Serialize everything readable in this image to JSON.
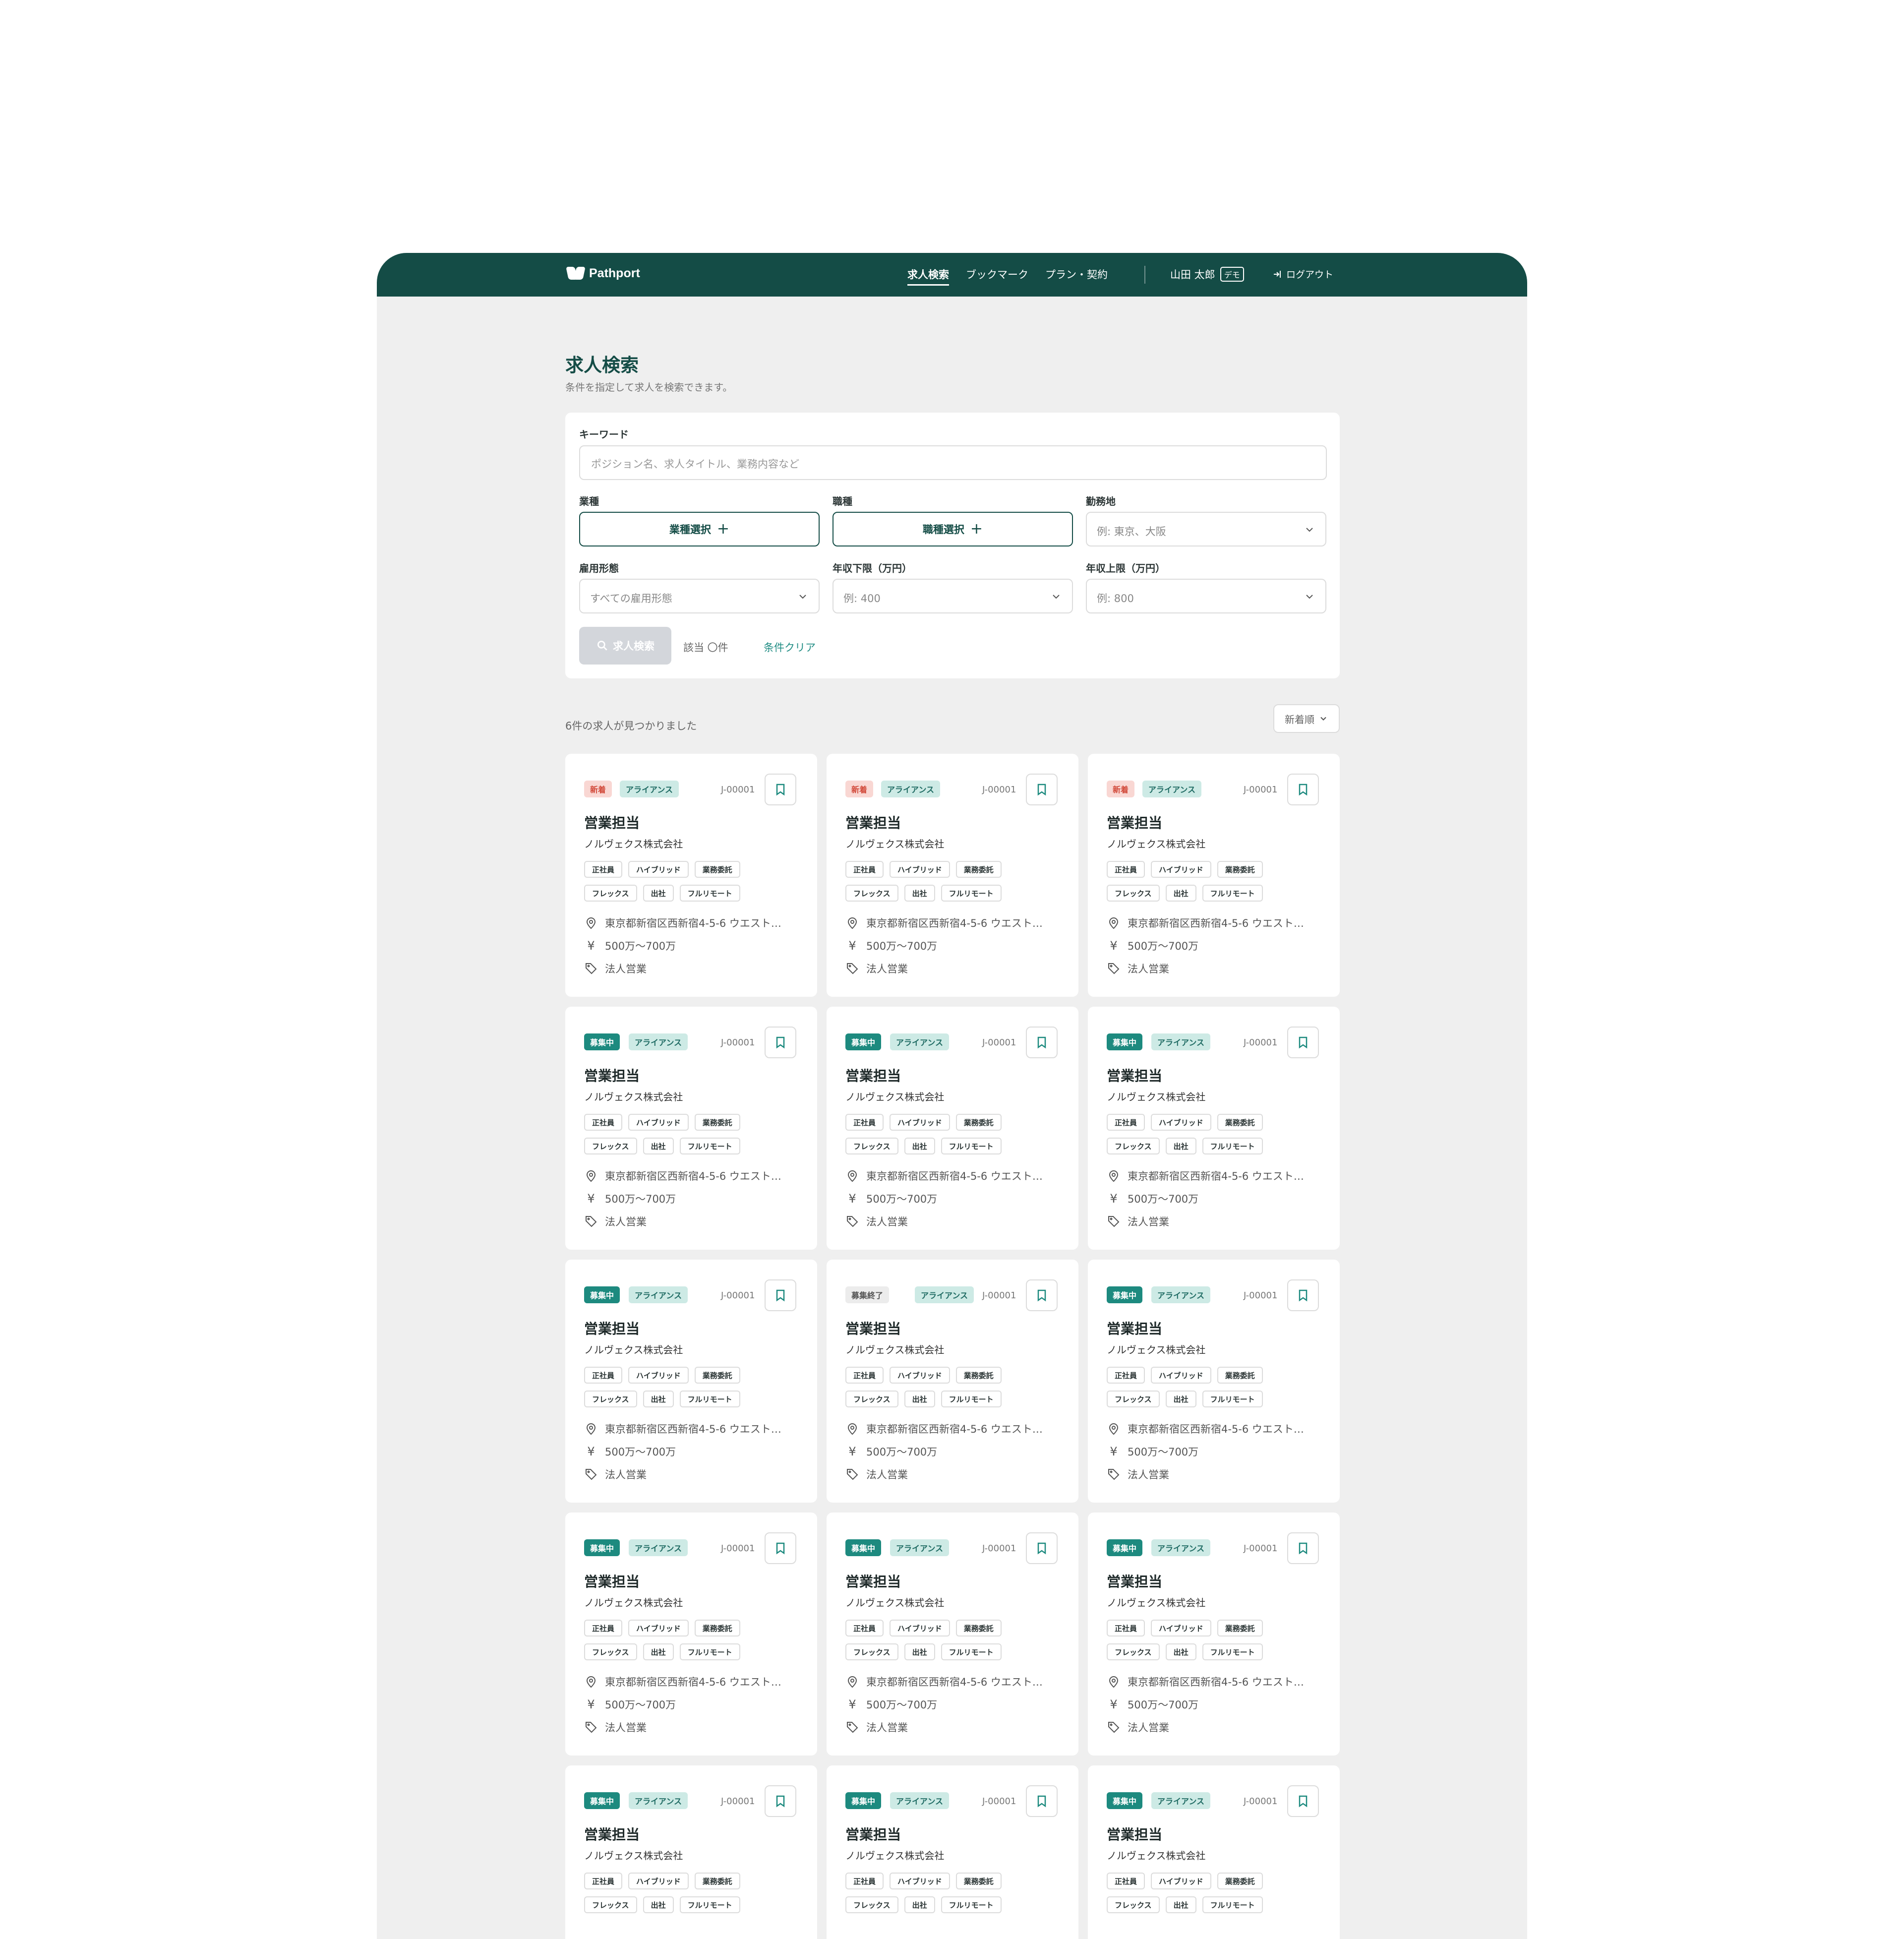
{
  "nav": {
    "logo": "Pathport",
    "links": [
      "求人検索",
      "ブックマーク",
      "プラン・契約"
    ],
    "user_name": "山田 太郎",
    "demo_label": "デモ",
    "logout": "ログアウト"
  },
  "page": {
    "title": "求人検索",
    "subtitle": "条件を指定して求人を検索できます。"
  },
  "search": {
    "keyword_label": "キーワード",
    "keyword_placeholder": "ポジション名、求人タイトル、業務内容など",
    "industry_label": "業種",
    "industry_button": "業種選択",
    "occupation_label": "職種",
    "occupation_button": "職種選択",
    "location_label": "勤務地",
    "location_placeholder": "例: 東京、大阪",
    "employment_label": "雇用形態",
    "employment_value": "すべての雇用形態",
    "salary_min_label": "年収下限（万円）",
    "salary_min_placeholder": "例: 400",
    "salary_max_label": "年収上限（万円）",
    "salary_max_placeholder": "例: 800",
    "search_button": "求人検索",
    "match_count": "該当 〇件",
    "clear_link": "条件クリア"
  },
  "results": {
    "count_text": "6件の求人が見つかりました",
    "sort_label": "新着順"
  },
  "alliance_label": "アライアンス",
  "cards": [
    {
      "status": "新着",
      "status_type": "new",
      "id": "J-00001",
      "title": "営業担当",
      "company": "ノルヴェクス株式会社",
      "tags_row1": [
        "正社員",
        "ハイブリッド",
        "業務委託"
      ],
      "tags_row2": [
        "フレックス",
        "出社",
        "フルリモート"
      ],
      "location": "東京都新宿区西新宿4-5-6 ウエスト…",
      "salary": "500万〜700万",
      "category": "法人営業"
    },
    {
      "status": "新着",
      "status_type": "new",
      "id": "J-00001",
      "title": "営業担当",
      "company": "ノルヴェクス株式会社",
      "tags_row1": [
        "正社員",
        "ハイブリッド",
        "業務委託"
      ],
      "tags_row2": [
        "フレックス",
        "出社",
        "フルリモート"
      ],
      "location": "東京都新宿区西新宿4-5-6 ウエスト…",
      "salary": "500万〜700万",
      "category": "法人営業"
    },
    {
      "status": "新着",
      "status_type": "new",
      "id": "J-00001",
      "title": "営業担当",
      "company": "ノルヴェクス株式会社",
      "tags_row1": [
        "正社員",
        "ハイブリッド",
        "業務委託"
      ],
      "tags_row2": [
        "フレックス",
        "出社",
        "フルリモート"
      ],
      "location": "東京都新宿区西新宿4-5-6 ウエスト…",
      "salary": "500万〜700万",
      "category": "法人営業"
    },
    {
      "status": "募集中",
      "status_type": "open",
      "id": "J-00001",
      "title": "営業担当",
      "company": "ノルヴェクス株式会社",
      "tags_row1": [
        "正社員",
        "ハイブリッド",
        "業務委託"
      ],
      "tags_row2": [
        "フレックス",
        "出社",
        "フルリモート"
      ],
      "location": "東京都新宿区西新宿4-5-6 ウエスト…",
      "salary": "500万〜700万",
      "category": "法人営業"
    },
    {
      "status": "募集中",
      "status_type": "open",
      "id": "J-00001",
      "title": "営業担当",
      "company": "ノルヴェクス株式会社",
      "tags_row1": [
        "正社員",
        "ハイブリッド",
        "業務委託"
      ],
      "tags_row2": [
        "フレックス",
        "出社",
        "フルリモート"
      ],
      "location": "東京都新宿区西新宿4-5-6 ウエスト…",
      "salary": "500万〜700万",
      "category": "法人営業"
    },
    {
      "status": "募集中",
      "status_type": "open",
      "id": "J-00001",
      "title": "営業担当",
      "company": "ノルヴェクス株式会社",
      "tags_row1": [
        "正社員",
        "ハイブリッド",
        "業務委託"
      ],
      "tags_row2": [
        "フレックス",
        "出社",
        "フルリモート"
      ],
      "location": "東京都新宿区西新宿4-5-6 ウエスト…",
      "salary": "500万〜700万",
      "category": "法人営業"
    },
    {
      "status": "募集中",
      "status_type": "open",
      "id": "J-00001",
      "title": "営業担当",
      "company": "ノルヴェクス株式会社",
      "tags_row1": [
        "正社員",
        "ハイブリッド",
        "業務委託"
      ],
      "tags_row2": [
        "フレックス",
        "出社",
        "フルリモート"
      ],
      "location": "東京都新宿区西新宿4-5-6 ウエスト…",
      "salary": "500万〜700万",
      "category": "法人営業"
    },
    {
      "status": "募集終了",
      "status_type": "closed",
      "id": "J-00001",
      "title": "営業担当",
      "company": "ノルヴェクス株式会社",
      "tags_row1": [
        "正社員",
        "ハイブリッド",
        "業務委託"
      ],
      "tags_row2": [
        "フレックス",
        "出社",
        "フルリモート"
      ],
      "location": "東京都新宿区西新宿4-5-6 ウエスト…",
      "salary": "500万〜700万",
      "category": "法人営業"
    },
    {
      "status": "募集中",
      "status_type": "open",
      "id": "J-00001",
      "title": "営業担当",
      "company": "ノルヴェクス株式会社",
      "tags_row1": [
        "正社員",
        "ハイブリッド",
        "業務委託"
      ],
      "tags_row2": [
        "フレックス",
        "出社",
        "フルリモート"
      ],
      "location": "東京都新宿区西新宿4-5-6 ウエスト…",
      "salary": "500万〜700万",
      "category": "法人営業"
    },
    {
      "status": "募集中",
      "status_type": "open",
      "id": "J-00001",
      "title": "営業担当",
      "company": "ノルヴェクス株式会社",
      "tags_row1": [
        "正社員",
        "ハイブリッド",
        "業務委託"
      ],
      "tags_row2": [
        "フレックス",
        "出社",
        "フルリモート"
      ],
      "location": "東京都新宿区西新宿4-5-6 ウエスト…",
      "salary": "500万〜700万",
      "category": "法人営業"
    },
    {
      "status": "募集中",
      "status_type": "open",
      "id": "J-00001",
      "title": "営業担当",
      "company": "ノルヴェクス株式会社",
      "tags_row1": [
        "正社員",
        "ハイブリッド",
        "業務委託"
      ],
      "tags_row2": [
        "フレックス",
        "出社",
        "フルリモート"
      ],
      "location": "東京都新宿区西新宿4-5-6 ウエスト…",
      "salary": "500万〜700万",
      "category": "法人営業"
    },
    {
      "status": "募集中",
      "status_type": "open",
      "id": "J-00001",
      "title": "営業担当",
      "company": "ノルヴェクス株式会社",
      "tags_row1": [
        "正社員",
        "ハイブリッド",
        "業務委託"
      ],
      "tags_row2": [
        "フレックス",
        "出社",
        "フルリモート"
      ],
      "location": "東京都新宿区西新宿4-5-6 ウエスト…",
      "salary": "500万〜700万",
      "category": "法人営業"
    },
    {
      "status": "募集中",
      "status_type": "open",
      "id": "J-00001",
      "title": "営業担当",
      "company": "ノルヴェクス株式会社",
      "tags_row1": [
        "正社員",
        "ハイブリッド",
        "業務委託"
      ],
      "tags_row2": [
        "フレックス",
        "出社",
        "フルリモート"
      ],
      "location": "",
      "salary": "",
      "category": ""
    },
    {
      "status": "募集中",
      "status_type": "open",
      "id": "J-00001",
      "title": "営業担当",
      "company": "ノルヴェクス株式会社",
      "tags_row1": [
        "正社員",
        "ハイブリッド",
        "業務委託"
      ],
      "tags_row2": [
        "フレックス",
        "出社",
        "フルリモート"
      ],
      "location": "",
      "salary": "",
      "category": ""
    },
    {
      "status": "募集中",
      "status_type": "open",
      "id": "J-00001",
      "title": "営業担当",
      "company": "ノルヴェクス株式会社",
      "tags_row1": [
        "正社員",
        "ハイブリッド",
        "業務委託"
      ],
      "tags_row2": [
        "フレックス",
        "出社",
        "フルリモート"
      ],
      "location": "",
      "salary": "",
      "category": ""
    }
  ]
}
